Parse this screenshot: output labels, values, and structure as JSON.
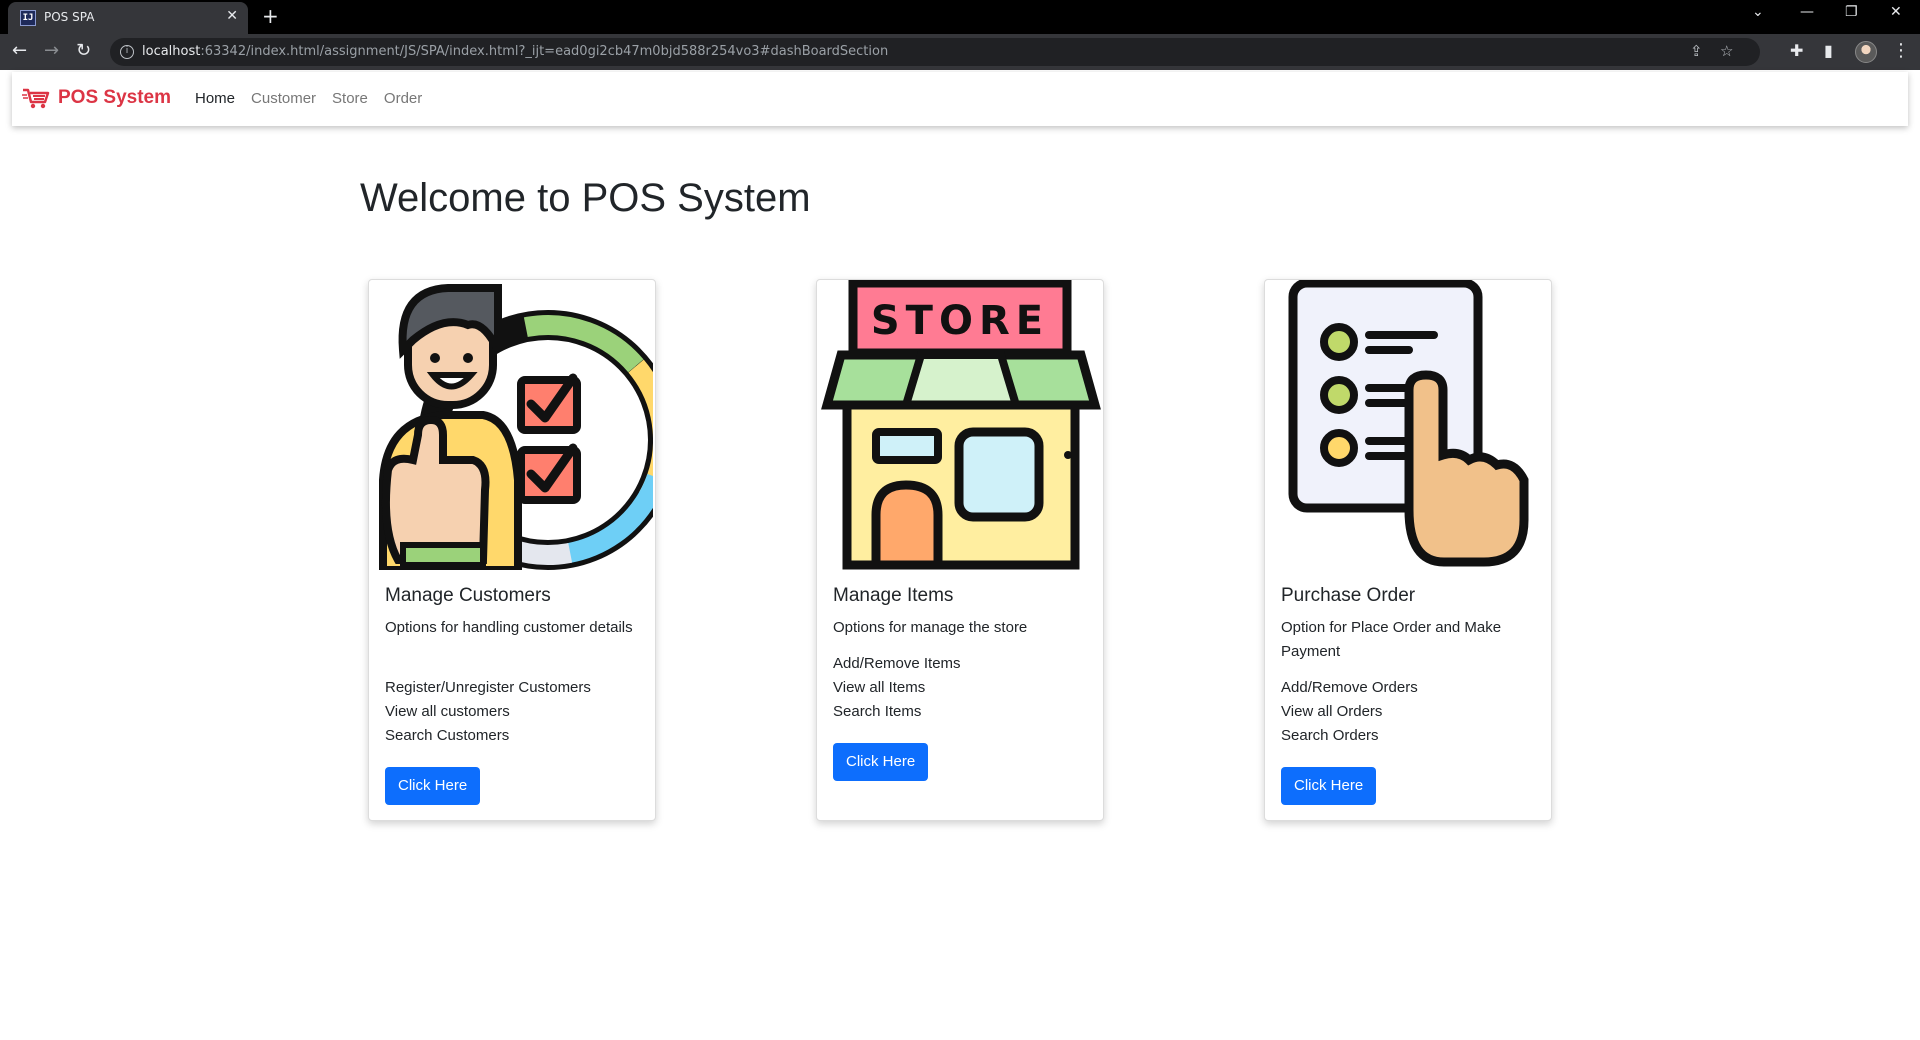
{
  "browser": {
    "tab_title": "POS SPA",
    "url_host": "localhost",
    "url_rest": ":63342/index.html/assignment/JS/SPA/index.html?_ijt=ead0gi2cb47m0bjd588r254vo3#dashBoardSection"
  },
  "navbar": {
    "brand": "POS System",
    "links": [
      {
        "label": "Home",
        "active": true
      },
      {
        "label": "Customer",
        "active": false
      },
      {
        "label": "Store",
        "active": false
      },
      {
        "label": "Order",
        "active": false
      }
    ]
  },
  "main": {
    "heading": "Welcome to POS System",
    "cards": [
      {
        "icon": "customer-checklist-icon",
        "title": "Manage Customers",
        "description": "Options for handling customer details",
        "items": [
          "Register/Unregister Customers",
          "View all customers",
          "Search Customers"
        ],
        "button": "Click Here"
      },
      {
        "icon": "store-icon",
        "title": "Manage Items",
        "description": "Options for manage the store",
        "items": [
          "Add/Remove Items",
          "View all Items",
          "Search Items"
        ],
        "button": "Click Here"
      },
      {
        "icon": "purchase-order-icon",
        "title": "Purchase Order",
        "description": "Option for Place Order and Make Payment",
        "items": [
          "Add/Remove Orders",
          "View all Orders",
          "Search Orders"
        ],
        "button": "Click Here"
      }
    ],
    "store_sign": "STORE"
  },
  "colors": {
    "brand": "#dc3545",
    "button": "#0d6efd"
  }
}
